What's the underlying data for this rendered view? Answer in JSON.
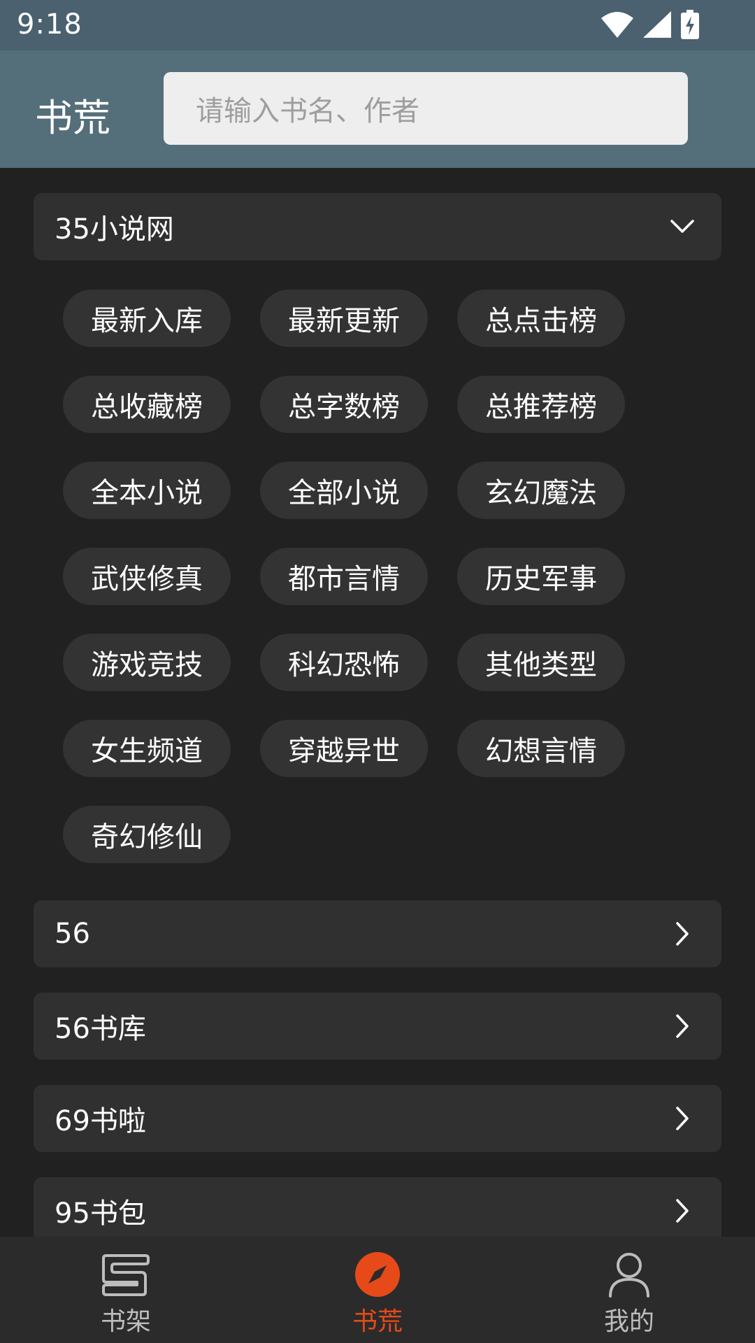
{
  "status_bar": {
    "time": "9:18"
  },
  "app_bar": {
    "title": "书荒",
    "search": {
      "placeholder": "请输入书名、作者"
    }
  },
  "sources": [
    {
      "name": "35小说网",
      "expanded": true,
      "categories": [
        "最新入库",
        "最新更新",
        "总点击榜",
        "总收藏榜",
        "总字数榜",
        "总推荐榜",
        "全本小说",
        "全部小说",
        "玄幻魔法",
        "武侠修真",
        "都市言情",
        "历史军事",
        "游戏竞技",
        "科幻恐怖",
        "其他类型",
        "女生频道",
        "穿越异世",
        "幻想言情",
        "奇幻修仙"
      ]
    },
    {
      "name": "56",
      "expanded": false
    },
    {
      "name": "56书库",
      "expanded": false
    },
    {
      "name": "69书啦",
      "expanded": false
    },
    {
      "name": "95书包",
      "expanded": false
    }
  ],
  "bottom_nav": {
    "items": [
      {
        "label": "书架",
        "icon": "bookshelf-icon",
        "active": false
      },
      {
        "label": "书荒",
        "icon": "compass-icon",
        "active": true
      },
      {
        "label": "我的",
        "icon": "person-icon",
        "active": false
      }
    ],
    "active_color": "#e64a19"
  }
}
